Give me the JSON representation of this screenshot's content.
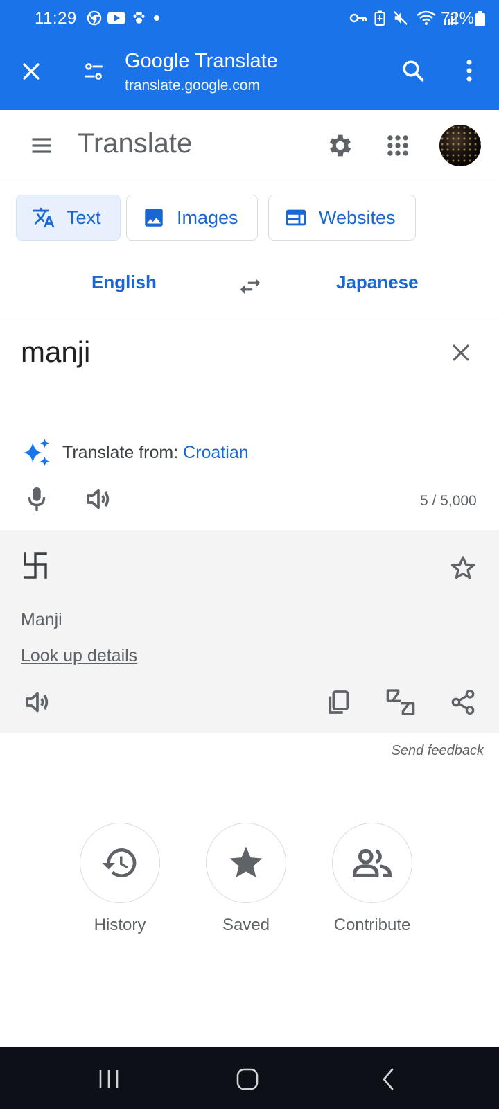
{
  "status_bar": {
    "time": "11:29",
    "battery": "72%",
    "left_icons": [
      "chrome-icon",
      "youtube-icon",
      "paw-icon",
      "dot-icon"
    ],
    "right_icons": [
      "key-icon",
      "battery-saver-icon",
      "mute-icon",
      "wifi-icon",
      "signal-icon",
      "battery-icon"
    ]
  },
  "browser": {
    "title": "Google Translate",
    "url": "translate.google.com"
  },
  "app": {
    "title": "Translate"
  },
  "modes": {
    "text": "Text",
    "images": "Images",
    "websites": "Websites",
    "active": "text"
  },
  "languages": {
    "source": "English",
    "target": "Japanese"
  },
  "input": {
    "text": "manji",
    "detect_prefix": "Translate from:",
    "detected_language": "Croatian",
    "char_count": "5 / 5,000"
  },
  "output": {
    "text": "卍",
    "transliteration": "Manji",
    "lookup": "Look up details"
  },
  "feedback": "Send feedback",
  "actions": {
    "history": "History",
    "saved": "Saved",
    "contribute": "Contribute"
  },
  "colors": {
    "brand_blue": "#1a73e8",
    "link_blue": "#1967d2",
    "active_chip": "#e8f0fe",
    "output_bg": "#f4f4f4",
    "nav_bg": "#0d1117"
  }
}
